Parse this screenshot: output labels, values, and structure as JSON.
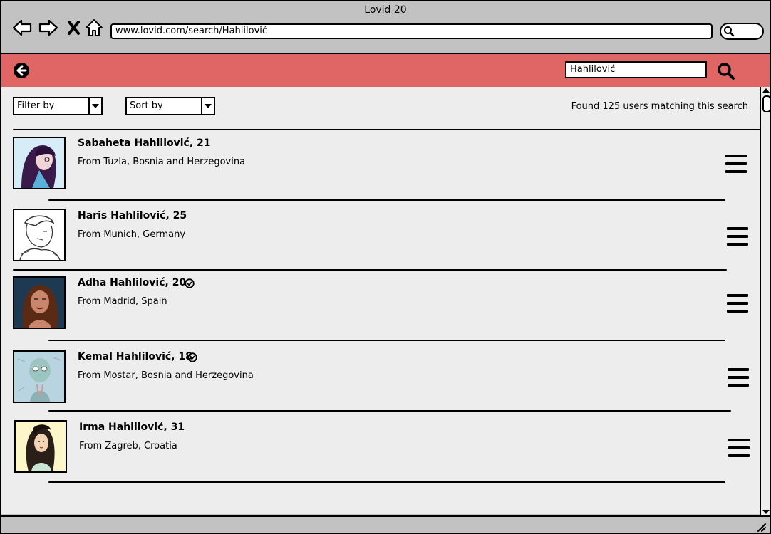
{
  "window": {
    "title": "Lovid 20"
  },
  "browser": {
    "url": "www.lovid.com/search/Hahlilović",
    "icons": [
      "back-arrow-icon",
      "forward-arrow-icon",
      "close-x-icon",
      "home-icon",
      "search-icon"
    ]
  },
  "appbar": {
    "search_value": "Hahlilović",
    "accent_color": "#e06666"
  },
  "filters": {
    "filter_label": "Filter by",
    "sort_label": "Sort by",
    "result_text": "Found 125 users matching this search"
  },
  "users": [
    {
      "name": "Sabaheta Hahlilović, 21",
      "from": "From Tuzla, Bosnia and Herzegovina",
      "verified": false
    },
    {
      "name": "Haris Hahlilović, 25",
      "from": "From Munich, Germany",
      "verified": false
    },
    {
      "name": "Adha Hahlilović, 20",
      "from": "From Madrid, Spain",
      "verified": true
    },
    {
      "name": "Kemal Hahlilović, 18",
      "from": "From Mostar, Bosnia and Herzegovina",
      "verified": true
    },
    {
      "name": "Irma Hahlilović, 31",
      "from": "From Zagreb, Croatia",
      "verified": false
    }
  ]
}
